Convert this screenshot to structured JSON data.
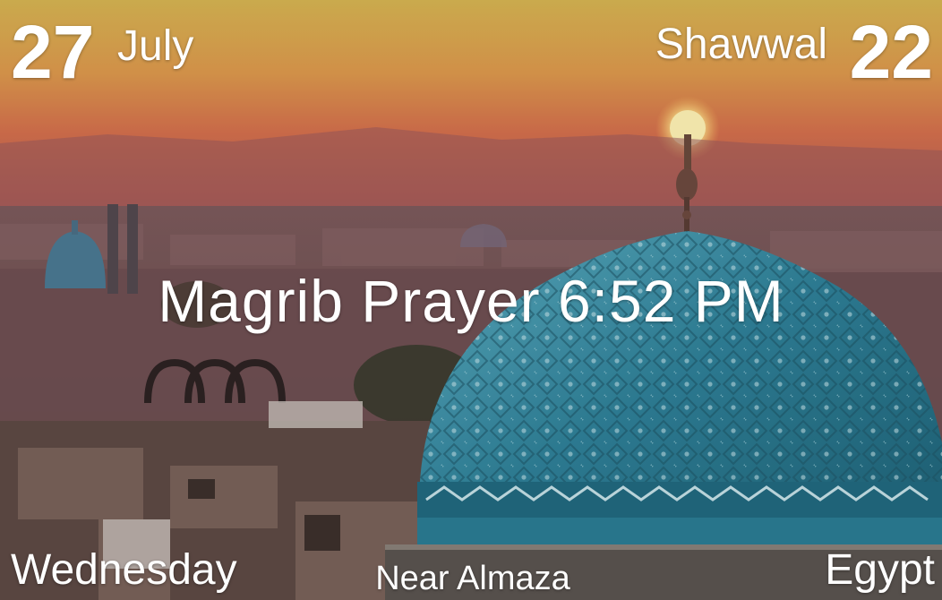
{
  "date": {
    "day": "27",
    "month": "July",
    "weekday": "Wednesday"
  },
  "hijri": {
    "month": "Shawwal",
    "day": "22"
  },
  "prayer": {
    "text": "Magrib Prayer 6:52 PM"
  },
  "location": {
    "area": "Near Almaza",
    "country": "Egypt"
  },
  "colors": {
    "sky_top": "#e3b451",
    "sky_mid": "#d8724c",
    "haze": "#9c5e5e",
    "dome_blue": "#3b8fa6",
    "text": "#ffffff"
  }
}
